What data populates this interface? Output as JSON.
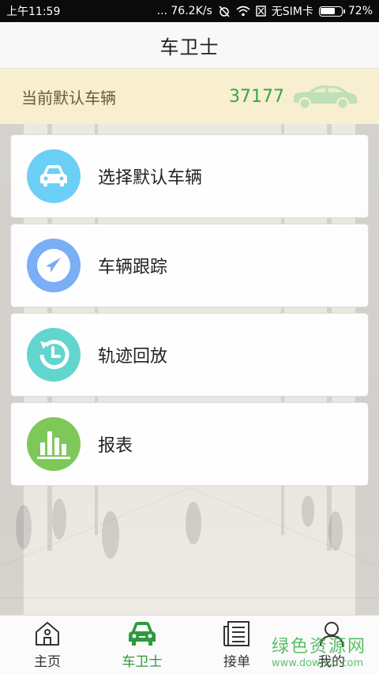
{
  "status_bar": {
    "time": "上午11:59",
    "network_speed": "... 76.2K/s",
    "sim": "无SIM卡",
    "battery": "72%",
    "battery_level": 0.72
  },
  "header": {
    "title": "车卫士"
  },
  "default_vehicle": {
    "label": "当前默认车辆",
    "plate": "37177"
  },
  "menu": {
    "items": [
      {
        "label": "选择默认车辆",
        "icon": "car-icon",
        "color": "#6ccff5"
      },
      {
        "label": "车辆跟踪",
        "icon": "navigation-arrow-icon",
        "color": "#7aaef5"
      },
      {
        "label": "轨迹回放",
        "icon": "history-clock-icon",
        "color": "#62d5cf"
      },
      {
        "label": "报表",
        "icon": "bar-chart-icon",
        "color": "#7ec85a"
      }
    ]
  },
  "bottom_nav": {
    "items": [
      {
        "label": "主页",
        "icon": "home-icon"
      },
      {
        "label": "车卫士",
        "icon": "car-icon",
        "active": true
      },
      {
        "label": "接单",
        "icon": "newspaper-icon"
      },
      {
        "label": "我的",
        "icon": "user-icon"
      }
    ]
  },
  "watermark": {
    "title": "绿色资源网",
    "url": "www.downcc.com"
  },
  "colors": {
    "accent": "#2e9a3e",
    "banner": "#f7efcf",
    "plate": "#3aa545"
  }
}
